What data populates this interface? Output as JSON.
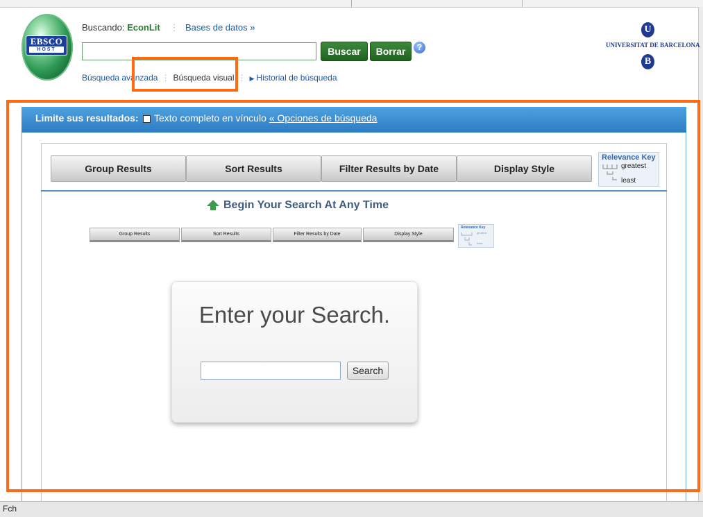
{
  "header": {
    "logo_line1": "EBSCO",
    "logo_line2": "HOST",
    "searching_label": "Buscando:",
    "database": "EconLit",
    "databases_link": "Bases de datos »",
    "search_button": "Buscar",
    "clear_button": "Borrar",
    "help_symbol": "?",
    "nav": {
      "advanced": "Búsqueda avanzada",
      "visual": "Búsqueda visual",
      "history": "Historial de búsqueda"
    },
    "university": {
      "letter_top": "U",
      "name": "UNIVERSITAT DE BARCELONA",
      "letter_bottom": "B"
    }
  },
  "limit_bar": {
    "label": "Limite sus resultados:",
    "option_text": "Texto completo en vínculo",
    "options_link": "« Opciones de búsqueda"
  },
  "toolbar": {
    "buttons": [
      "Group Results",
      "Sort Results",
      "Filter Results by Date",
      "Display Style"
    ]
  },
  "relevance_key": {
    "title": "Relevance Key",
    "greatest": "greatest",
    "least": "least"
  },
  "begin_search": "Begin Your Search At Any Time",
  "search_card": {
    "title": "Enter your Search.",
    "button": "Search"
  },
  "status_bar": {
    "text": "Fch"
  },
  "colors": {
    "highlight": "#ff6a13",
    "bar_blue": "#2d7bc4",
    "green_button": "#2a6e2a"
  }
}
